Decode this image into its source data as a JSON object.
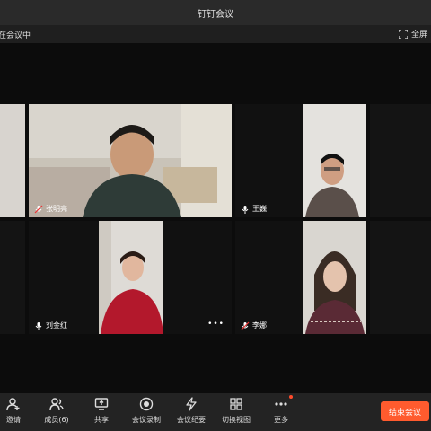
{
  "window": {
    "title": "钉钉会议"
  },
  "status": {
    "meeting_status": "在会议中",
    "fullscreen_label": "全屏"
  },
  "participants": [
    {
      "name": "张明亮"
    },
    {
      "name": "王巍"
    },
    {
      "name": "刘金红"
    },
    {
      "name": "李娜"
    }
  ],
  "toolbar": {
    "invite": "邀请",
    "members": "成员(6)",
    "share": "共享",
    "record": "会议录制",
    "minutes": "会议纪要",
    "switch_view": "切换视图",
    "more": "更多",
    "end_meeting": "结束会议"
  },
  "colors": {
    "end_button": "#ff5b2e",
    "background": "#000000"
  }
}
